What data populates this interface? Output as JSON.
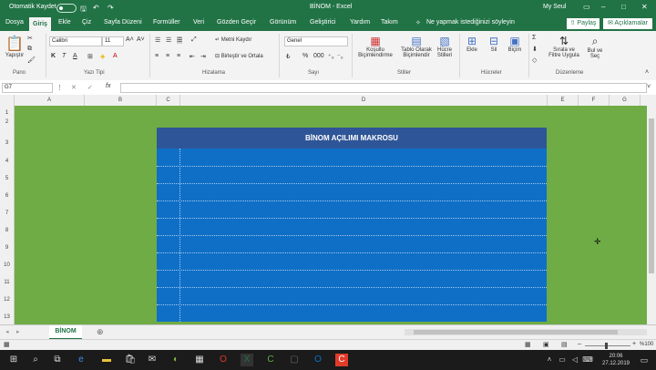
{
  "titlebar": {
    "autosave_label": "Otomatik Kaydet",
    "autosave_state": "Kapalı",
    "doc_title": "BİNOM - Excel",
    "user": "My Seul"
  },
  "tabs": [
    "Dosya",
    "Giriş",
    "Ekle",
    "Çiz",
    "Sayfa Düzeni",
    "Formüller",
    "Veri",
    "Gözden Geçir",
    "Görünüm",
    "Geliştirici",
    "Yardım",
    "Takım"
  ],
  "tell_me": "Ne yapmak istediğinizi söyleyin",
  "share_label": "Paylaş",
  "comments_label": "Açıklamalar",
  "ribbon": {
    "paste_label": "Yapıştır",
    "clipboard_label": "Pano",
    "font_name": "Calibri",
    "font_size": "11",
    "font_group_label": "Yazı Tipi",
    "bold": "K",
    "italic": "T",
    "underline": "A",
    "wrap_text": "Metni Kaydır",
    "merge_center": "Birleştir ve Ortala",
    "alignment_label": "Hizalama",
    "number_format": "Genel",
    "number_label": "Sayı",
    "cond_format": "Koşullu Biçimlendirme",
    "format_table": "Tablo Olarak Biçimlendir",
    "cell_styles": "Hücre Stilleri",
    "styles_label": "Stiller",
    "insert": "Ekle",
    "delete": "Sil",
    "format": "Biçim",
    "cells_label": "Hücreler",
    "sort_filter": "Sırala ve Filtre Uygula",
    "find_select": "Bul ve Seç",
    "editing_label": "Düzenleme"
  },
  "formula_bar": {
    "name_box": "G7",
    "fx": "fx",
    "value": ""
  },
  "columns": [
    "A",
    "B",
    "C",
    "D",
    "E",
    "F",
    "G"
  ],
  "rows": [
    "1",
    "2",
    "3",
    "4",
    "5",
    "6",
    "7",
    "8",
    "9",
    "10",
    "11",
    "12",
    "13"
  ],
  "macro_title": "BİNOM AÇILIMI MAKROSU",
  "sheet_tab": "BİNOM",
  "zoom": "%100",
  "clock": {
    "time": "20:06",
    "date": "27.12.2019"
  }
}
